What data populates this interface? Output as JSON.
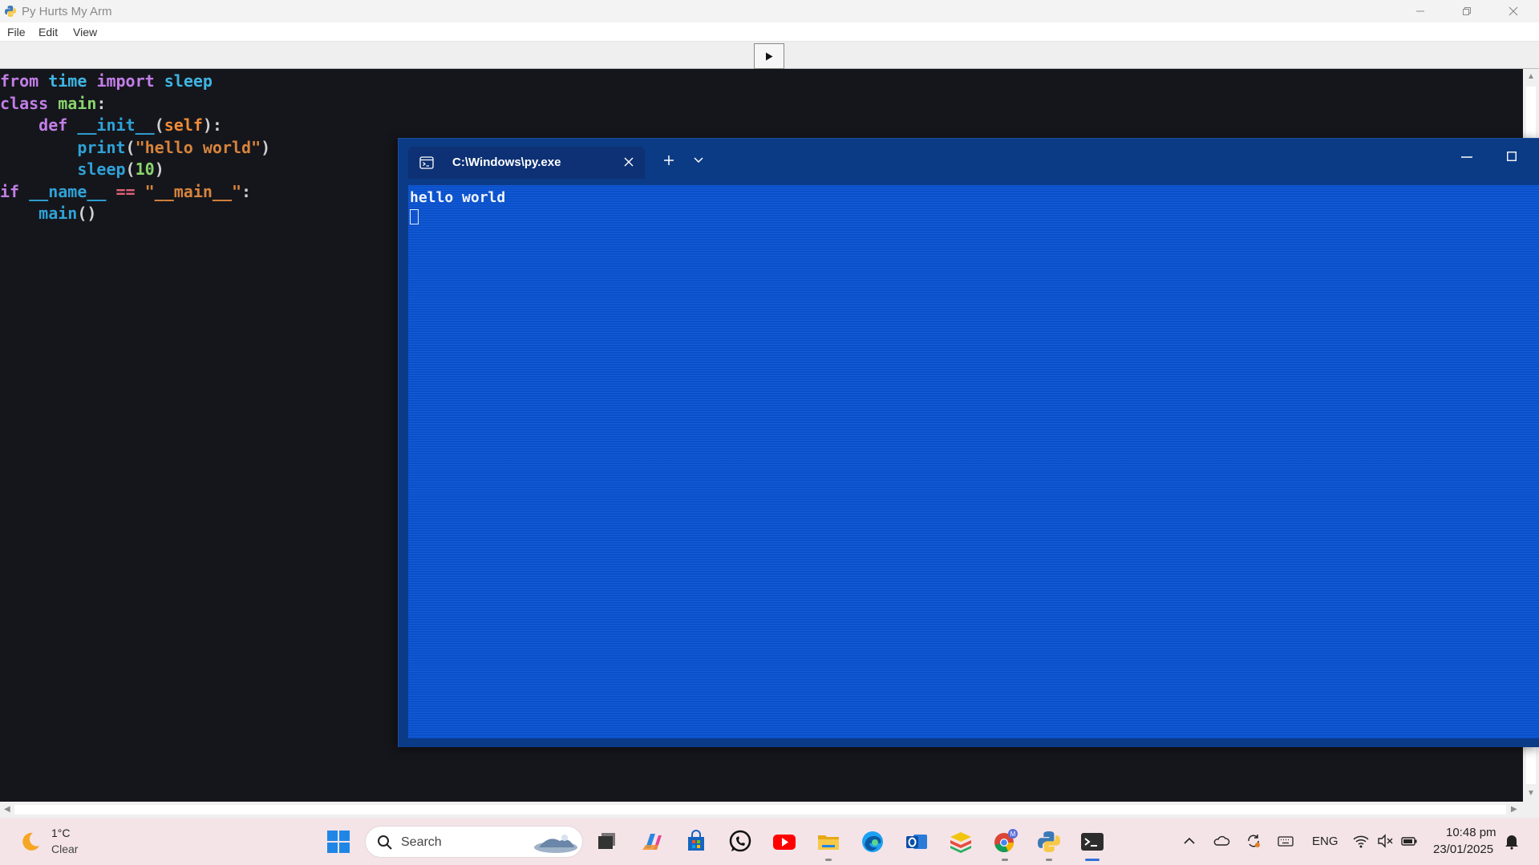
{
  "window": {
    "title": "Py Hurts My Arm"
  },
  "menu": {
    "items": [
      "File",
      "Edit",
      "View"
    ]
  },
  "toolbar": {
    "run_icon": "play-icon"
  },
  "editor": {
    "lines": [
      [
        {
          "t": "from ",
          "c": "kw"
        },
        {
          "t": "time ",
          "c": "mod"
        },
        {
          "t": "import ",
          "c": "kw"
        },
        {
          "t": "sleep",
          "c": "mod"
        }
      ],
      [
        {
          "t": "class ",
          "c": "kw"
        },
        {
          "t": "main",
          "c": "cls"
        },
        {
          "t": ":",
          "c": "txt"
        }
      ],
      [
        {
          "t": "    def ",
          "c": "kw"
        },
        {
          "t": "__init__",
          "c": "fn"
        },
        {
          "t": "(",
          "c": "txt"
        },
        {
          "t": "self",
          "c": "slf"
        },
        {
          "t": "):",
          "c": "txt"
        }
      ],
      [
        {
          "t": "        print",
          "c": "fn"
        },
        {
          "t": "(",
          "c": "txt"
        },
        {
          "t": "\"hello world\"",
          "c": "str"
        },
        {
          "t": ")",
          "c": "txt"
        }
      ],
      [
        {
          "t": "        sleep",
          "c": "fn"
        },
        {
          "t": "(",
          "c": "txt"
        },
        {
          "t": "10",
          "c": "num"
        },
        {
          "t": ")",
          "c": "txt"
        }
      ],
      [
        {
          "t": "if ",
          "c": "kw"
        },
        {
          "t": "__name__ ",
          "c": "fn"
        },
        {
          "t": "== ",
          "c": "op"
        },
        {
          "t": "\"__main__\"",
          "c": "str"
        },
        {
          "t": ":",
          "c": "txt"
        }
      ],
      [
        {
          "t": "    main",
          "c": "fn"
        },
        {
          "t": "()",
          "c": "txt"
        }
      ]
    ]
  },
  "terminal": {
    "tab_title": "C:\\Windows\\py.exe",
    "output": "hello world"
  },
  "taskbar": {
    "weather_temp": "1°C",
    "weather_condition": "Clear",
    "search_placeholder": "Search",
    "language": "ENG",
    "time": "10:48 pm",
    "date": "23/01/2025"
  },
  "colors": {
    "editor_bg": "#15161b",
    "terminal_bg": "#0a54d4",
    "taskbar_bg": "#f4e4e8"
  }
}
